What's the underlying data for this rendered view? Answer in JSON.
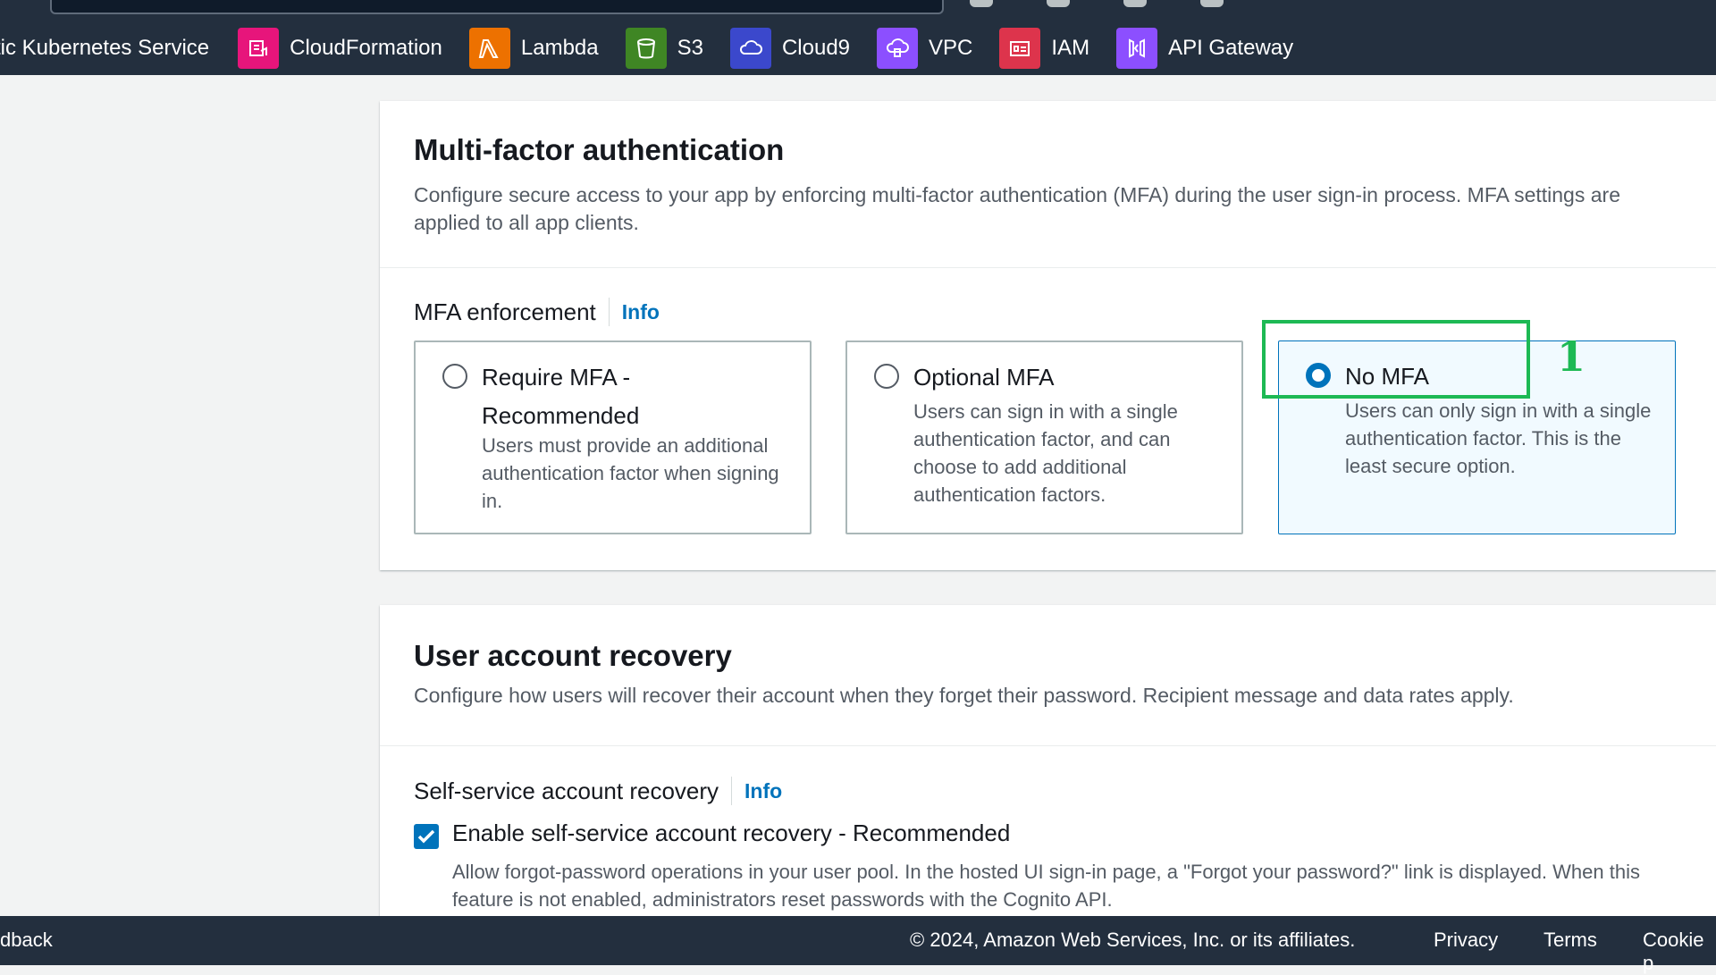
{
  "topnav": {
    "favorites": [
      {
        "label": "tic Kubernetes Service",
        "icon": "kubernetes-icon",
        "color": ""
      },
      {
        "label": "CloudFormation",
        "icon": "cloudformation-icon",
        "color": "#e7157b"
      },
      {
        "label": "Lambda",
        "icon": "lambda-icon",
        "color": "#ed7100"
      },
      {
        "label": "S3",
        "icon": "s3-bucket-icon",
        "color": "#3f8624"
      },
      {
        "label": "Cloud9",
        "icon": "cloud9-icon",
        "color": "#4d27aa"
      },
      {
        "label": "VPC",
        "icon": "vpc-icon",
        "color": "#8c4fff"
      },
      {
        "label": "IAM",
        "icon": "iam-icon",
        "color": "#dd344c"
      },
      {
        "label": "API Gateway",
        "icon": "api-gateway-icon",
        "color": "#8c4fff"
      }
    ]
  },
  "mfa": {
    "title": "Multi-factor authentication",
    "description": "Configure secure access to your app by enforcing multi-factor authentication (MFA) during the user sign-in process. MFA settings are applied to all app clients.",
    "enforcement_label": "MFA enforcement",
    "info_label": "Info",
    "options": [
      {
        "title": "Require MFA - Recommended",
        "description": "Users must provide an additional authentication factor when signing in.",
        "selected": false
      },
      {
        "title": "Optional MFA",
        "description": "Users can sign in with a single authentication factor, and can choose to add additional authentication factors.",
        "selected": false
      },
      {
        "title": "No MFA",
        "description": "Users can only sign in with a single authentication factor. This is the least secure option.",
        "selected": true
      }
    ]
  },
  "annotation": {
    "number": "1",
    "color": "#1db954"
  },
  "recovery": {
    "title": "User account recovery",
    "description": "Configure how users will recover their account when they forget their password. Recipient message and data rates apply.",
    "self_service_label": "Self-service account recovery",
    "info_label": "Info",
    "checkbox_label": "Enable self-service account recovery - Recommended",
    "checkbox_checked": true,
    "checkbox_description": "Allow forgot-password operations in your user pool. In the hosted UI sign-in page, a \"Forgot your password?\" link is displayed. When this feature is not enabled, administrators reset passwords with the Cognito API."
  },
  "footer": {
    "feedback": "dback",
    "copyright": "© 2024, Amazon Web Services, Inc. or its affiliates.",
    "privacy": "Privacy",
    "terms": "Terms",
    "cookie": "Cookie p"
  },
  "colors": {
    "accent": "#0073bb",
    "nav_bg": "#232f3e"
  }
}
